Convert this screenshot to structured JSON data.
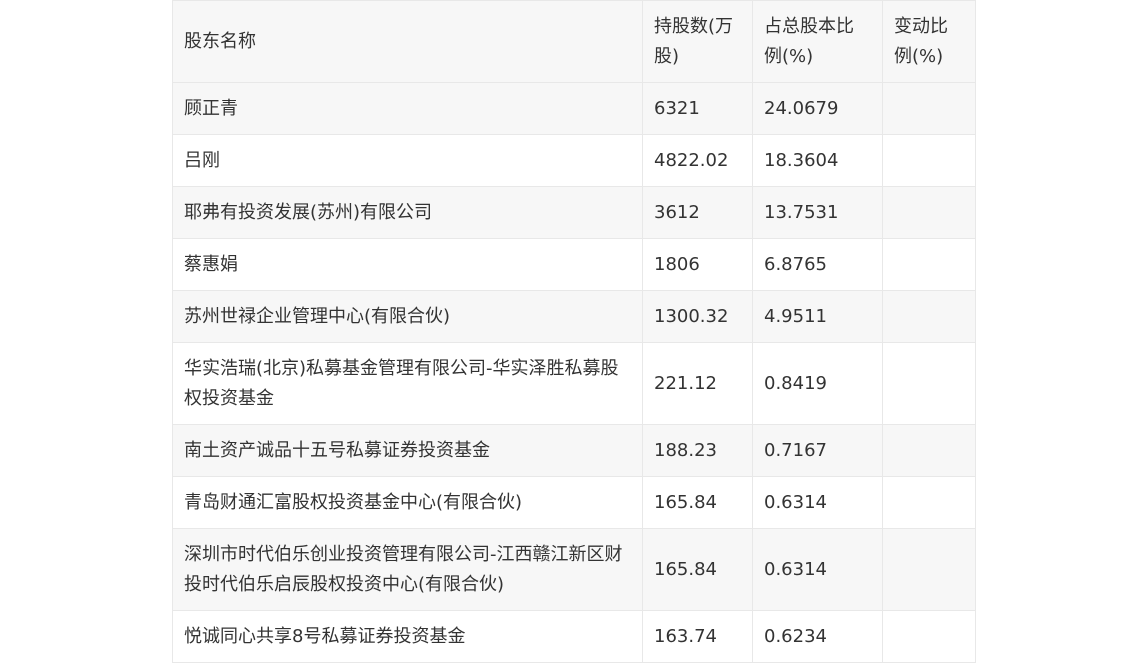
{
  "table": {
    "headers": [
      "股东名称",
      "持股数(万股)",
      "占总股本比例(%)",
      "变动比例(%)"
    ],
    "rows": [
      [
        "顾正青",
        "6321",
        "24.0679",
        ""
      ],
      [
        "吕刚",
        "4822.02",
        "18.3604",
        ""
      ],
      [
        "耶弗有投资发展(苏州)有限公司",
        "3612",
        "13.7531",
        ""
      ],
      [
        "蔡惠娟",
        "1806",
        "6.8765",
        ""
      ],
      [
        "苏州世禄企业管理中心(有限合伙)",
        "1300.32",
        "4.9511",
        ""
      ],
      [
        "华实浩瑞(北京)私募基金管理有限公司-华实泽胜私募股权投资基金",
        "221.12",
        "0.8419",
        ""
      ],
      [
        "南土资产诚品十五号私募证券投资基金",
        "188.23",
        "0.7167",
        ""
      ],
      [
        "青岛财通汇富股权投资基金中心(有限合伙)",
        "165.84",
        "0.6314",
        ""
      ],
      [
        "深圳市时代伯乐创业投资管理有限公司-江西赣江新区财投时代伯乐启辰股权投资中心(有限合伙)",
        "165.84",
        "0.6314",
        ""
      ],
      [
        "悦诚同心共享8号私募证券投资基金",
        "163.74",
        "0.6234",
        ""
      ]
    ]
  }
}
